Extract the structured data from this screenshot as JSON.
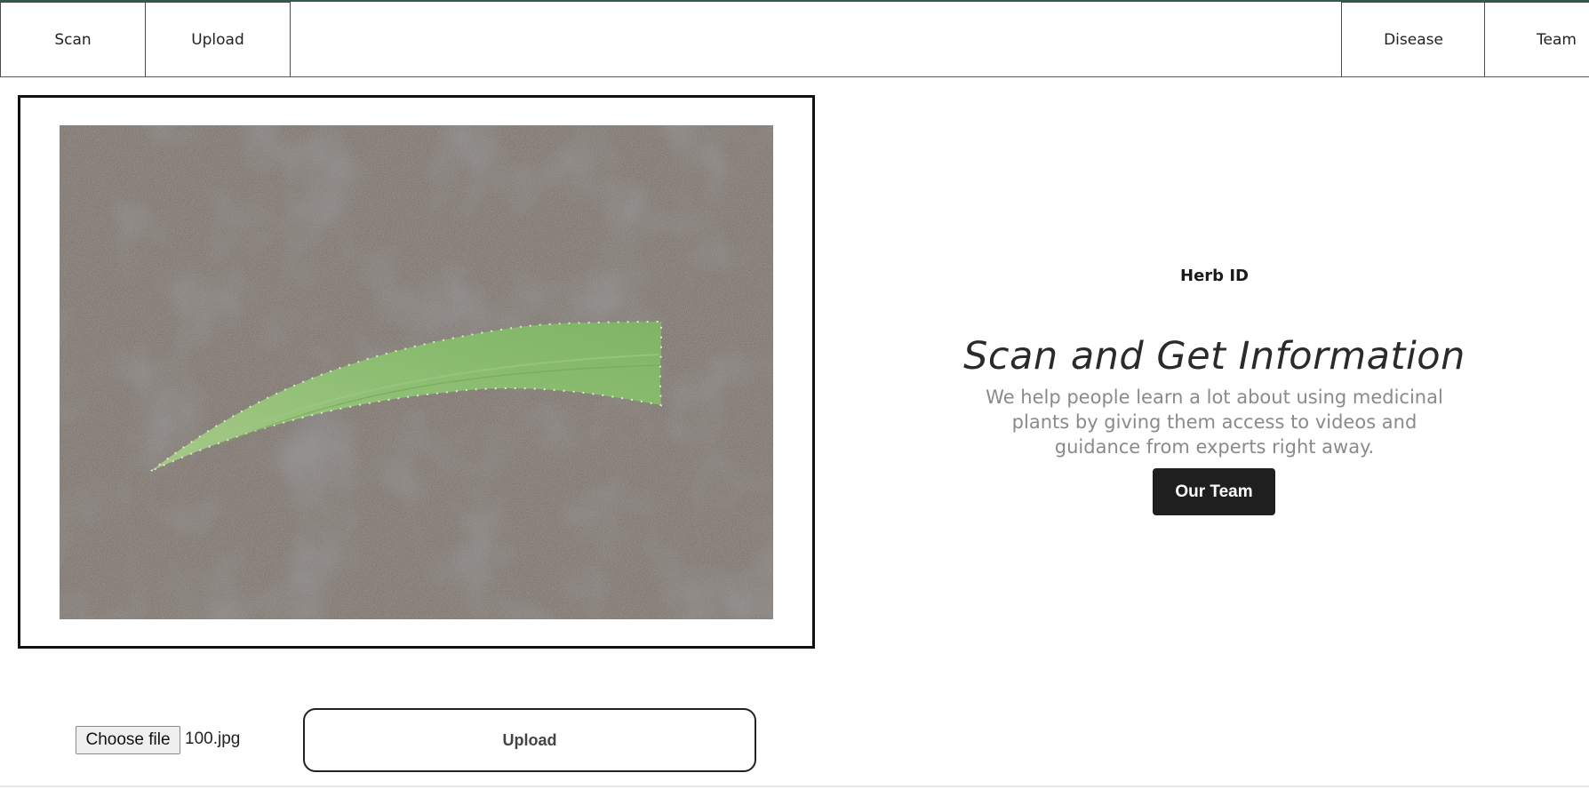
{
  "nav": {
    "left": [
      {
        "label": "Scan"
      },
      {
        "label": "Upload"
      }
    ],
    "right": [
      {
        "label": "Disease"
      },
      {
        "label": "Team"
      }
    ]
  },
  "hero": {
    "eyebrow": "Herb ID",
    "title": "Scan and Get Information",
    "description": "We help people learn a lot about using medicinal plants by giving them access to videos and guidance from experts right away.",
    "cta_label": "Our Team"
  },
  "upload_form": {
    "choose_label": "Choose file",
    "file_name": "100.jpg",
    "submit_label": "Upload"
  },
  "colors": {
    "accent_top": "#2f5b4b",
    "button_dark": "#1f1f1f"
  }
}
